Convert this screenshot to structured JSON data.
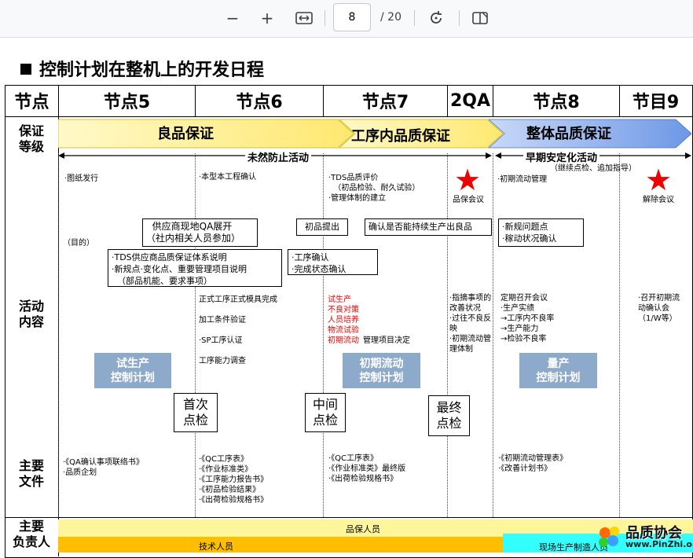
{
  "toolbar": {
    "zoom_out_icon": "−",
    "zoom_in_icon": "+",
    "fit_icon": "fit-width-icon",
    "page_current": "8",
    "page_total": "/ 20",
    "rotate_icon": "rotate-icon",
    "two_page_icon": "two-page-icon"
  },
  "slide": {
    "title": "控制计划在整机上的开发日程",
    "headers": [
      "节点",
      "节点5",
      "节点6",
      "节点7",
      "2QA",
      "节点8",
      "节目9"
    ],
    "row_labels": {
      "level": "保证\n等级",
      "activity": "活动\n内容",
      "docs": "主要\n文件",
      "owner": "主要\n负责人"
    },
    "phases": {
      "good_quality": "良品保证",
      "in_process": "工序内品质保证",
      "overall": "整体品质保证"
    },
    "arrows": {
      "prevention": "未然防止活动",
      "early_stabilize": "早期安定化活动",
      "early_stabilize_sub": "（继续点检、追加指导）"
    },
    "milestones": {
      "drawing": "·图纸发行",
      "proto_confirm": "·本型本工程确认",
      "tds": "·TDS品质评价\n  （初品检验、耐久试验）\n·管理体制的建立",
      "qa_meeting": "品保会议",
      "initial_flow": "·初期流动管理",
      "release_meeting": "解除会议"
    },
    "purpose": "（目的）",
    "boxes": {
      "supplier_qa": "  供应商现地QA展开\n（社内相关人员参加）",
      "tds_supplier": "·TDS供应商品质保证体系说明\n·新规点·变化点、重要管理项目说明\n  （部品机能、要求事项）",
      "first_submit": "初品提出",
      "confirm_stable": "确认是否能持续生产出良品",
      "process_confirm": "·工序确认\n·完成状态确认",
      "new_issue": "·新规问题点\n·稼动状况确认"
    },
    "activities": {
      "col6": "正式工序正式模具完成\n\n加工条件验证\n\n·SP工序认证\n\n工序能力调查",
      "col7_red": "试生产\n不良对策\n人员培养\n物流试验\n初期流动",
      "col7_black": "管理项目决定",
      "col2qa": "·指摘事项的\n改善状况\n·过往不良反\n映\n·初期流动管\n理体制",
      "col8": "定期召开会议\n·生产实绩\n→工序内不良率\n→生产能力\n→检验不良率",
      "col9": "·召开初期流\n动确认会\n（1/W等）"
    },
    "control_plans": {
      "trial": "试生产\n控制计划",
      "initial": "初期流动\n控制计划",
      "mass": "量产\n控制计划"
    },
    "checkpoints": {
      "first": "首次\n点检",
      "middle": "中间\n点检",
      "final": "最终\n点检"
    },
    "documents": {
      "col5": "·《QA确认事项联络书》\n·品质企划",
      "col6": "·《QC工序表》\n·《作业标准类》\n·《工序能力报告书》\n·《初品检验结果》\n·《出荷检验规格书》",
      "col7": "·《QC工序表》\n·《作业标准类》最终版\n·《出荷检验规格书》",
      "col8": "·《初期流动管理表》\n·《改善计划书》"
    },
    "owners": {
      "qa_staff": "品保人员",
      "tech_staff": "技术人员",
      "field_staff": "现场生产制造人员"
    },
    "watermark": {
      "name": "品质协会",
      "url": "www.PinZhi.org"
    },
    "colors": {
      "arrow_yellow": "#fff2a0",
      "arrow_blue": "#8fb0ea",
      "bar_yellow": "#fff59a",
      "bar_orange": "#ffbf00",
      "bar_cyan": "#33ffff",
      "star_red": "#ee0000",
      "control_blue": "#8eaacb"
    }
  }
}
